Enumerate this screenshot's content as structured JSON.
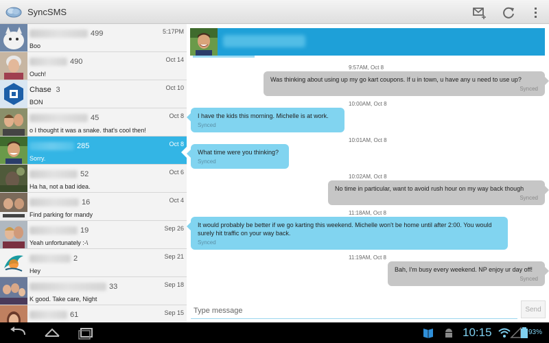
{
  "app": {
    "title": "SyncSMS"
  },
  "conversations": [
    {
      "name": "",
      "count": "499",
      "date": "5:17PM",
      "snippet": "Boo",
      "avatar": "white-cat"
    },
    {
      "name": "",
      "count": "490",
      "date": "Oct 14",
      "snippet": "Ouch!",
      "avatar": "elderly-woman"
    },
    {
      "name": "Chase",
      "count": "3",
      "date": "Oct 10",
      "snippet": "BON",
      "avatar": "chase-logo"
    },
    {
      "name": "",
      "count": "45",
      "date": "Oct 8",
      "snippet": "o I thought it was a snake. that's cool then!",
      "avatar": "couple"
    },
    {
      "name": "",
      "count": "285",
      "date": "Oct 8",
      "snippet": "Sorry.",
      "avatar": "man-smiling",
      "selected": true
    },
    {
      "name": "",
      "count": "52",
      "date": "Oct 6",
      "snippet": "Ha ha, not a bad idea.",
      "avatar": "outdoor"
    },
    {
      "name": "",
      "count": "16",
      "date": "Oct 4",
      "snippet": "Find parking for mandy",
      "avatar": "couple-sign"
    },
    {
      "name": "",
      "count": "19",
      "date": "Sep 26",
      "snippet": "Yeah unfortunately :-\\",
      "avatar": "couple-2"
    },
    {
      "name": "",
      "count": "2",
      "date": "Sep 21",
      "snippet": "Hey",
      "avatar": "dolphins-logo"
    },
    {
      "name": "",
      "count": "33",
      "date": "Sep 18",
      "snippet": "K good. Take care, Night",
      "avatar": "family"
    },
    {
      "name": "",
      "count": "61",
      "date": "Sep 15",
      "snippet": "",
      "avatar": "woman"
    }
  ],
  "thread": {
    "messages": [
      {
        "dir": "out",
        "text": "Was thinking about using up my go kart coupons. If u in town, u have any u need to use up?",
        "status": "Synced",
        "time": "9:57AM, Oct 8"
      },
      {
        "dir": "in",
        "text": "I have the kids this morning. Michelle is at work.",
        "status": "Synced",
        "time": "10:00AM, Oct 8"
      },
      {
        "dir": "in",
        "text": "What time were you thinking?",
        "status": "Synced",
        "time": "10:01AM, Oct 8"
      },
      {
        "dir": "out",
        "text": "No time in particular, want to avoid rush hour on my way back though",
        "status": "Synced",
        "time": "10:02AM, Oct 8"
      },
      {
        "dir": "in",
        "text": "It would probably be better if we go karting this weekend. Michelle won't be home until after 2:00. You would surely hit traffic on your way back.",
        "status": "Synced",
        "time": "11:18AM, Oct 8"
      },
      {
        "dir": "out",
        "text": "Bah, I'm busy every weekend. NP enjoy ur day off!",
        "status": "Synced",
        "time": "11:19AM, Oct 8"
      }
    ],
    "compose_placeholder": "Type message",
    "send_label": "Send"
  },
  "status": {
    "time": "10:15",
    "battery": "93%"
  },
  "colors": {
    "accent": "#33b5e5",
    "incoming": "#81d4f0",
    "outgoing": "#c6c6c6",
    "header": "#1ea0d8"
  }
}
